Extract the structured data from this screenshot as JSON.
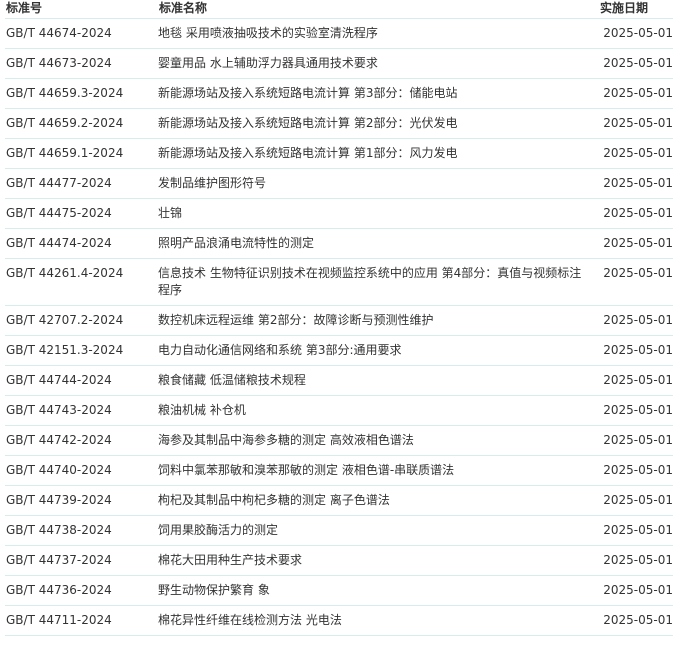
{
  "table": {
    "headers": {
      "code": "标准号",
      "name": "标准名称",
      "date": "实施日期"
    },
    "rows": [
      {
        "code": "GB/T 44674-2024",
        "name": "地毯 采用喷液抽吸技术的实验室清洗程序",
        "date": "2025-05-01"
      },
      {
        "code": "GB/T 44673-2024",
        "name": "婴童用品 水上辅助浮力器具通用技术要求",
        "date": "2025-05-01"
      },
      {
        "code": "GB/T 44659.3-2024",
        "name": "新能源场站及接入系统短路电流计算 第3部分：储能电站",
        "date": "2025-05-01"
      },
      {
        "code": "GB/T 44659.2-2024",
        "name": "新能源场站及接入系统短路电流计算 第2部分：光伏发电",
        "date": "2025-05-01"
      },
      {
        "code": "GB/T 44659.1-2024",
        "name": "新能源场站及接入系统短路电流计算 第1部分：风力发电",
        "date": "2025-05-01"
      },
      {
        "code": "GB/T 44477-2024",
        "name": "发制品维护图形符号",
        "date": "2025-05-01"
      },
      {
        "code": "GB/T 44475-2024",
        "name": "壮锦",
        "date": "2025-05-01"
      },
      {
        "code": "GB/T 44474-2024",
        "name": "照明产品浪涌电流特性的测定",
        "date": "2025-05-01"
      },
      {
        "code": "GB/T 44261.4-2024",
        "name": "信息技术 生物特征识别技术在视频监控系统中的应用 第4部分：真值与视频标注程序",
        "date": "2025-05-01"
      },
      {
        "code": "GB/T 42707.2-2024",
        "name": "数控机床远程运维 第2部分：故障诊断与预测性维护",
        "date": "2025-05-01"
      },
      {
        "code": "GB/T 42151.3-2024",
        "name": "电力自动化通信网络和系统 第3部分:通用要求",
        "date": "2025-05-01"
      },
      {
        "code": "GB/T 44744-2024",
        "name": "粮食储藏 低温储粮技术规程",
        "date": "2025-05-01"
      },
      {
        "code": "GB/T 44743-2024",
        "name": "粮油机械 补仓机",
        "date": "2025-05-01"
      },
      {
        "code": "GB/T 44742-2024",
        "name": "海参及其制品中海参多糖的测定 高效液相色谱法",
        "date": "2025-05-01"
      },
      {
        "code": "GB/T 44740-2024",
        "name": "饲料中氯苯那敏和溴苯那敏的测定 液相色谱-串联质谱法",
        "date": "2025-05-01"
      },
      {
        "code": "GB/T 44739-2024",
        "name": "枸杞及其制品中枸杞多糖的测定 离子色谱法",
        "date": "2025-05-01"
      },
      {
        "code": "GB/T 44738-2024",
        "name": "饲用果胶酶活力的测定",
        "date": "2025-05-01"
      },
      {
        "code": "GB/T 44737-2024",
        "name": "棉花大田用种生产技术要求",
        "date": "2025-05-01"
      },
      {
        "code": "GB/T 44736-2024",
        "name": "野生动物保护繁育 象",
        "date": "2025-05-01"
      },
      {
        "code": "GB/T 44711-2024",
        "name": "棉花异性纤维在线检测方法 光电法",
        "date": "2025-05-01"
      }
    ]
  }
}
